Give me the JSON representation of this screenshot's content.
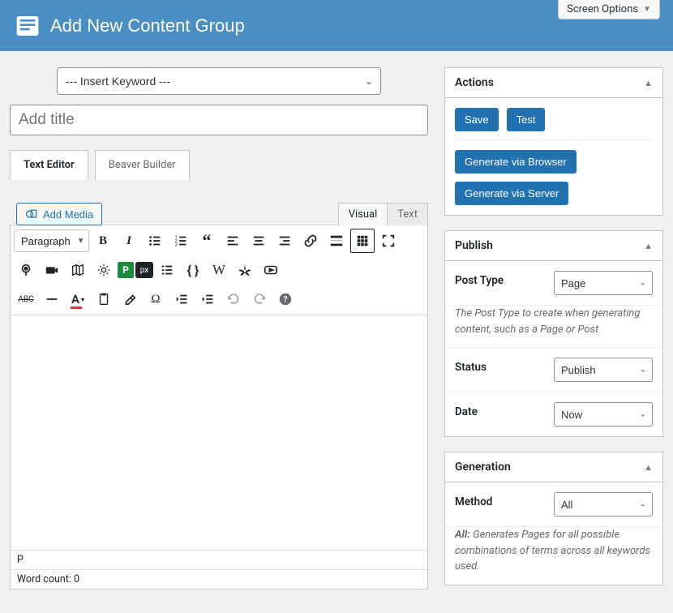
{
  "header": {
    "title": "Add New Content Group",
    "screen_options": "Screen Options"
  },
  "keyword_select": {
    "placeholder": "--- Insert Keyword ---"
  },
  "title_field": {
    "placeholder": "Add title"
  },
  "editor_tabs": {
    "text_editor": "Text Editor",
    "beaver_builder": "Beaver Builder"
  },
  "add_media": "Add Media",
  "mode_tabs": {
    "visual": "Visual",
    "text": "Text"
  },
  "format_select": "Paragraph",
  "toolbar_icons": {
    "bold": "bold-icon",
    "italic": "italic-icon",
    "ul": "unordered-list-icon",
    "ol": "ordered-list-icon",
    "quote": "blockquote-icon",
    "al": "align-left-icon",
    "ac": "align-center-icon",
    "ar": "align-right-icon",
    "link": "link-icon",
    "more": "read-more-icon",
    "kbd": "toolbar-toggle-icon",
    "fs": "fullscreen-icon",
    "pin": "pin-icon",
    "cam": "camera-icon",
    "map": "map-icon",
    "sun": "sun-icon",
    "pbox": "p-box-icon",
    "pix": "pixabay-icon",
    "list2": "list-icon",
    "braces": "braces-icon",
    "wiki": "wikipedia-icon",
    "yelp": "yelp-icon",
    "yt": "youtube-icon",
    "abc": "abc-icon",
    "hr": "hr-icon",
    "txtcolor": "text-color-icon",
    "paste": "paste-icon",
    "erase": "clear-format-icon",
    "omega": "special-char-icon",
    "outdent": "outdent-icon",
    "indent": "indent-icon",
    "undo": "undo-icon",
    "redo": "redo-icon",
    "help": "help-icon"
  },
  "editor_footer": {
    "path": "P",
    "word_count_label": "Word count: ",
    "word_count_value": "0"
  },
  "panels": {
    "actions": {
      "title": "Actions",
      "save": "Save",
      "test": "Test",
      "browser": "Generate via Browser",
      "server": "Generate via Server"
    },
    "publish": {
      "title": "Publish",
      "post_type_label": "Post Type",
      "post_type_value": "Page",
      "post_type_help": "The Post Type to create when generating content, such as a Page or Post",
      "status_label": "Status",
      "status_value": "Publish",
      "date_label": "Date",
      "date_value": "Now"
    },
    "generation": {
      "title": "Generation",
      "method_label": "Method",
      "method_value": "All",
      "method_help_bold": "All:",
      "method_help": " Generates Pages for all possible combinations of terms across all keywords used."
    }
  }
}
